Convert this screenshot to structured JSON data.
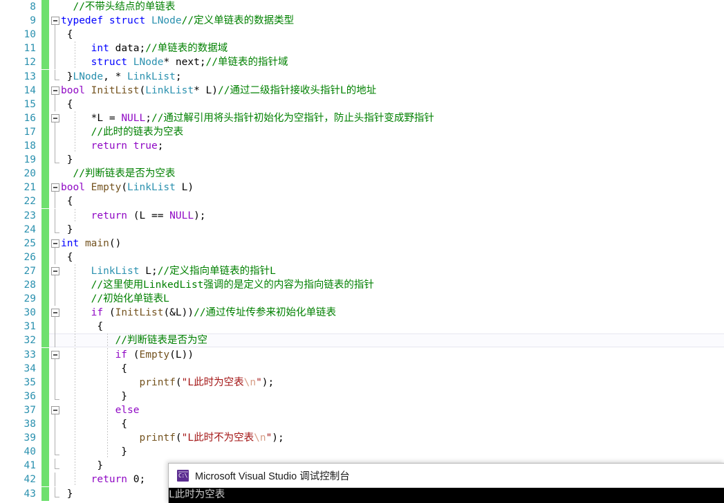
{
  "editor": {
    "first_line_number": 8,
    "current_line_number": 32,
    "change_bar_color": "#6ee06e",
    "line_number_color": "#2b91af",
    "lines": [
      {
        "num": "8",
        "indent": 1,
        "fold": "none",
        "guides": [],
        "tokens": [
          {
            "t": "  ",
            "c": "t-pl"
          },
          {
            "t": "//不带头结点的单链表",
            "c": "t-cmt"
          }
        ]
      },
      {
        "num": "9",
        "indent": 1,
        "fold": "box",
        "guides": [],
        "tokens": [
          {
            "t": "typedef",
            "c": "t-kw"
          },
          {
            "t": " ",
            "c": "t-pl"
          },
          {
            "t": "struct",
            "c": "t-kw"
          },
          {
            "t": " ",
            "c": "t-pl"
          },
          {
            "t": "LNode",
            "c": "t-type"
          },
          {
            "t": "//定义单链表的数据类型",
            "c": "t-cmt"
          }
        ]
      },
      {
        "num": "10",
        "indent": 1,
        "fold": "line",
        "guides": [],
        "tokens": [
          {
            "t": " {",
            "c": "t-pl"
          }
        ]
      },
      {
        "num": "11",
        "indent": 2,
        "fold": "line",
        "guides": [
          108
        ],
        "tokens": [
          {
            "t": "     ",
            "c": "t-pl"
          },
          {
            "t": "int",
            "c": "t-kw"
          },
          {
            "t": " data;",
            "c": "t-pl"
          },
          {
            "t": "//单链表的数据域",
            "c": "t-cmt"
          }
        ]
      },
      {
        "num": "12",
        "indent": 2,
        "fold": "line",
        "guides": [
          108
        ],
        "tokens": [
          {
            "t": "     ",
            "c": "t-pl"
          },
          {
            "t": "struct",
            "c": "t-kw"
          },
          {
            "t": " ",
            "c": "t-pl"
          },
          {
            "t": "LNode",
            "c": "t-type"
          },
          {
            "t": "* next;",
            "c": "t-pl"
          },
          {
            "t": "//单链表的指针域",
            "c": "t-cmt"
          }
        ]
      },
      {
        "num": "13",
        "indent": 1,
        "fold": "endcap",
        "guides": [],
        "tokens": [
          {
            "t": " }",
            "c": "t-pl"
          },
          {
            "t": "LNode",
            "c": "t-type"
          },
          {
            "t": ", * ",
            "c": "t-pl"
          },
          {
            "t": "LinkList",
            "c": "t-type"
          },
          {
            "t": ";",
            "c": "t-pl"
          }
        ]
      },
      {
        "num": "14",
        "indent": 1,
        "fold": "box",
        "guides": [],
        "tokens": [
          {
            "t": "bool",
            "c": "t-kw2"
          },
          {
            "t": " ",
            "c": "t-pl"
          },
          {
            "t": "InitList",
            "c": "t-fn"
          },
          {
            "t": "(",
            "c": "t-pl"
          },
          {
            "t": "LinkList",
            "c": "t-type"
          },
          {
            "t": "* L)",
            "c": "t-pl"
          },
          {
            "t": "//通过二级指针接收头指针L的地址",
            "c": "t-cmt"
          }
        ]
      },
      {
        "num": "15",
        "indent": 1,
        "fold": "line",
        "guides": [],
        "tokens": [
          {
            "t": " {",
            "c": "t-pl"
          }
        ]
      },
      {
        "num": "16",
        "indent": 2,
        "fold": "box",
        "guides": [
          108
        ],
        "tokens": [
          {
            "t": "     *L = ",
            "c": "t-pl"
          },
          {
            "t": "NULL",
            "c": "t-mac"
          },
          {
            "t": ";",
            "c": "t-pl"
          },
          {
            "t": "//通过解引用将头指针初始化为空指针，防止头指针变成野指针",
            "c": "t-cmt"
          }
        ]
      },
      {
        "num": "17",
        "indent": 2,
        "fold": "line",
        "guides": [
          108
        ],
        "tokens": [
          {
            "t": "     ",
            "c": "t-pl"
          },
          {
            "t": "//此时的链表为空表",
            "c": "t-cmt"
          }
        ]
      },
      {
        "num": "18",
        "indent": 2,
        "fold": "line",
        "guides": [
          108
        ],
        "tokens": [
          {
            "t": "     ",
            "c": "t-pl"
          },
          {
            "t": "return",
            "c": "t-kw2"
          },
          {
            "t": " ",
            "c": "t-pl"
          },
          {
            "t": "true",
            "c": "t-kw2"
          },
          {
            "t": ";",
            "c": "t-pl"
          }
        ]
      },
      {
        "num": "19",
        "indent": 1,
        "fold": "endcap",
        "guides": [],
        "tokens": [
          {
            "t": " }",
            "c": "t-pl"
          }
        ]
      },
      {
        "num": "20",
        "indent": 1,
        "fold": "none",
        "guides": [],
        "tokens": [
          {
            "t": "  ",
            "c": "t-pl"
          },
          {
            "t": "//判断链表是否为空表",
            "c": "t-cmt"
          }
        ]
      },
      {
        "num": "21",
        "indent": 1,
        "fold": "box",
        "guides": [],
        "tokens": [
          {
            "t": "bool",
            "c": "t-kw2"
          },
          {
            "t": " ",
            "c": "t-pl"
          },
          {
            "t": "Empty",
            "c": "t-fn"
          },
          {
            "t": "(",
            "c": "t-pl"
          },
          {
            "t": "LinkList",
            "c": "t-type"
          },
          {
            "t": " L)",
            "c": "t-pl"
          }
        ]
      },
      {
        "num": "22",
        "indent": 1,
        "fold": "line",
        "guides": [],
        "tokens": [
          {
            "t": " {",
            "c": "t-pl"
          }
        ]
      },
      {
        "num": "23",
        "indent": 2,
        "fold": "line",
        "guides": [
          108
        ],
        "tokens": [
          {
            "t": "     ",
            "c": "t-pl"
          },
          {
            "t": "return",
            "c": "t-kw2"
          },
          {
            "t": " (L == ",
            "c": "t-pl"
          },
          {
            "t": "NULL",
            "c": "t-mac"
          },
          {
            "t": ");",
            "c": "t-pl"
          }
        ]
      },
      {
        "num": "24",
        "indent": 1,
        "fold": "endcap",
        "guides": [],
        "tokens": [
          {
            "t": " }",
            "c": "t-pl"
          }
        ]
      },
      {
        "num": "25",
        "indent": 1,
        "fold": "box",
        "guides": [],
        "tokens": [
          {
            "t": "int",
            "c": "t-kw"
          },
          {
            "t": " ",
            "c": "t-pl"
          },
          {
            "t": "main",
            "c": "t-fn"
          },
          {
            "t": "()",
            "c": "t-pl"
          }
        ]
      },
      {
        "num": "26",
        "indent": 1,
        "fold": "line",
        "guides": [],
        "tokens": [
          {
            "t": " {",
            "c": "t-pl"
          }
        ]
      },
      {
        "num": "27",
        "indent": 2,
        "fold": "box",
        "guides": [
          108
        ],
        "tokens": [
          {
            "t": "     ",
            "c": "t-pl"
          },
          {
            "t": "LinkList",
            "c": "t-type"
          },
          {
            "t": " L;",
            "c": "t-pl"
          },
          {
            "t": "//定义指向单链表的指针L",
            "c": "t-cmt"
          }
        ]
      },
      {
        "num": "28",
        "indent": 2,
        "fold": "line",
        "guides": [
          108
        ],
        "tokens": [
          {
            "t": "     ",
            "c": "t-pl"
          },
          {
            "t": "//这里使用LinkedList强调的是定义的内容为指向链表的指针",
            "c": "t-cmt"
          }
        ]
      },
      {
        "num": "29",
        "indent": 2,
        "fold": "line",
        "guides": [
          108
        ],
        "tokens": [
          {
            "t": "     ",
            "c": "t-pl"
          },
          {
            "t": "//初始化单链表L",
            "c": "t-cmt"
          }
        ]
      },
      {
        "num": "30",
        "indent": 2,
        "fold": "box",
        "guides": [
          108
        ],
        "tokens": [
          {
            "t": "     ",
            "c": "t-pl"
          },
          {
            "t": "if",
            "c": "t-kw2"
          },
          {
            "t": " (",
            "c": "t-pl"
          },
          {
            "t": "InitList",
            "c": "t-fn"
          },
          {
            "t": "(&L))",
            "c": "t-pl"
          },
          {
            "t": "//通过传址传参来初始化单链表",
            "c": "t-cmt"
          }
        ]
      },
      {
        "num": "31",
        "indent": 2,
        "fold": "line",
        "guides": [
          108
        ],
        "tokens": [
          {
            "t": "      {",
            "c": "t-pl"
          }
        ]
      },
      {
        "num": "32",
        "indent": 3,
        "fold": "line",
        "guides": [
          108,
          155
        ],
        "tokens": [
          {
            "t": "         ",
            "c": "t-pl"
          },
          {
            "t": "//判断链表是否为空",
            "c": "t-cmt"
          }
        ]
      },
      {
        "num": "33",
        "indent": 3,
        "fold": "box",
        "guides": [
          108,
          155
        ],
        "tokens": [
          {
            "t": "         ",
            "c": "t-pl"
          },
          {
            "t": "if",
            "c": "t-kw2"
          },
          {
            "t": " (",
            "c": "t-pl"
          },
          {
            "t": "Empty",
            "c": "t-fn"
          },
          {
            "t": "(L))",
            "c": "t-pl"
          }
        ]
      },
      {
        "num": "34",
        "indent": 3,
        "fold": "line",
        "guides": [
          108,
          155
        ],
        "tokens": [
          {
            "t": "          {",
            "c": "t-pl"
          }
        ]
      },
      {
        "num": "35",
        "indent": 4,
        "fold": "line",
        "guides": [
          108,
          155
        ],
        "tokens": [
          {
            "t": "             ",
            "c": "t-pl"
          },
          {
            "t": "printf",
            "c": "t-fn"
          },
          {
            "t": "(",
            "c": "t-pl"
          },
          {
            "t": "\"L此时为空表",
            "c": "t-str"
          },
          {
            "t": "\\n",
            "c": "t-esc"
          },
          {
            "t": "\"",
            "c": "t-str"
          },
          {
            "t": ");",
            "c": "t-pl"
          }
        ]
      },
      {
        "num": "36",
        "indent": 3,
        "fold": "endcap",
        "guides": [
          108,
          155
        ],
        "tokens": [
          {
            "t": "          }",
            "c": "t-pl"
          }
        ]
      },
      {
        "num": "37",
        "indent": 3,
        "fold": "box",
        "guides": [
          108,
          155
        ],
        "tokens": [
          {
            "t": "         ",
            "c": "t-pl"
          },
          {
            "t": "else",
            "c": "t-kw2"
          }
        ]
      },
      {
        "num": "38",
        "indent": 3,
        "fold": "line",
        "guides": [
          108,
          155
        ],
        "tokens": [
          {
            "t": "          {",
            "c": "t-pl"
          }
        ]
      },
      {
        "num": "39",
        "indent": 4,
        "fold": "line",
        "guides": [
          108,
          155
        ],
        "tokens": [
          {
            "t": "             ",
            "c": "t-pl"
          },
          {
            "t": "printf",
            "c": "t-fn"
          },
          {
            "t": "(",
            "c": "t-pl"
          },
          {
            "t": "\"L此时不为空表",
            "c": "t-str"
          },
          {
            "t": "\\n",
            "c": "t-esc"
          },
          {
            "t": "\"",
            "c": "t-str"
          },
          {
            "t": ");",
            "c": "t-pl"
          }
        ]
      },
      {
        "num": "40",
        "indent": 3,
        "fold": "endcap",
        "guides": [
          108,
          155
        ],
        "tokens": [
          {
            "t": "          }",
            "c": "t-pl"
          }
        ]
      },
      {
        "num": "41",
        "indent": 2,
        "fold": "endcap",
        "guides": [
          108
        ],
        "tokens": [
          {
            "t": "      }",
            "c": "t-pl"
          }
        ]
      },
      {
        "num": "42",
        "indent": 2,
        "fold": "line",
        "guides": [
          108
        ],
        "tokens": [
          {
            "t": "     ",
            "c": "t-pl"
          },
          {
            "t": "return",
            "c": "t-kw2"
          },
          {
            "t": " 0;",
            "c": "t-pl"
          }
        ]
      },
      {
        "num": "43",
        "indent": 1,
        "fold": "endcap",
        "guides": [],
        "tokens": [
          {
            "t": " }",
            "c": "t-pl"
          }
        ]
      }
    ]
  },
  "console": {
    "icon_name": "cmd-prompt-icon",
    "icon_glyph": "C:\\",
    "title": "Microsoft Visual Studio 调试控制台",
    "output_lines": [
      "L此时为空表"
    ]
  }
}
